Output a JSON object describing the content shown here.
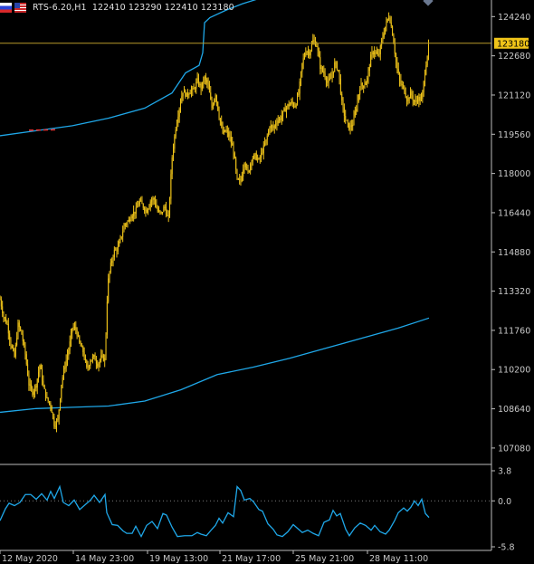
{
  "header": {
    "symbol": "RTS-6.20",
    "timeframe": "H1",
    "open": "122410",
    "high": "123290",
    "low": "122410",
    "close": "123180"
  },
  "colors": {
    "background": "#000000",
    "candle_up": "#f0c419",
    "candle_down": "#f0c419",
    "bands": "#1fa7e8",
    "oscillator": "#1fa7e8",
    "price_line": "#b89a2a",
    "axis_text": "#c8c8c8",
    "current_price_label_bg": "#f0c419",
    "band_marker_red": "#e03030"
  },
  "chart_data": [
    {
      "type": "candlestick",
      "panel": "main",
      "ylim": [
        106500,
        124900
      ],
      "y_ticks": [
        "124240",
        "122680",
        "121120",
        "119560",
        "118000",
        "116440",
        "114880",
        "113320",
        "111760",
        "110200",
        "108640",
        "107080"
      ],
      "current_price": "123180",
      "x_ticks": [
        "12 May 2020",
        "14 May 23:00",
        "19 May 13:00",
        "21 May 17:00",
        "25 May 21:00",
        "28 May 11:00"
      ],
      "close_path": [
        [
          0,
          113000
        ],
        [
          4,
          112300
        ],
        [
          8,
          112000
        ],
        [
          12,
          111200
        ],
        [
          16,
          110700
        ],
        [
          20,
          112000
        ],
        [
          24,
          111600
        ],
        [
          28,
          110800
        ],
        [
          32,
          109600
        ],
        [
          36,
          109300
        ],
        [
          40,
          109600
        ],
        [
          44,
          110400
        ],
        [
          48,
          109500
        ],
        [
          52,
          109000
        ],
        [
          56,
          108800
        ],
        [
          60,
          108000
        ],
        [
          64,
          108200
        ],
        [
          68,
          109700
        ],
        [
          72,
          110400
        ],
        [
          76,
          111000
        ],
        [
          80,
          111900
        ],
        [
          84,
          111800
        ],
        [
          88,
          111200
        ],
        [
          92,
          110900
        ],
        [
          96,
          110200
        ],
        [
          100,
          110600
        ],
        [
          104,
          110700
        ],
        [
          108,
          110400
        ],
        [
          112,
          110700
        ],
        [
          116,
          110600
        ],
        [
          119,
          113600
        ],
        [
          122,
          114300
        ],
        [
          126,
          114900
        ],
        [
          130,
          115000
        ],
        [
          134,
          115500
        ],
        [
          138,
          116000
        ],
        [
          142,
          116100
        ],
        [
          146,
          116400
        ],
        [
          150,
          116500
        ],
        [
          154,
          116900
        ],
        [
          158,
          116700
        ],
        [
          162,
          116500
        ],
        [
          166,
          116900
        ],
        [
          170,
          117000
        ],
        [
          174,
          116500
        ],
        [
          178,
          116400
        ],
        [
          182,
          116700
        ],
        [
          186,
          116100
        ],
        [
          190,
          118600
        ],
        [
          194,
          119800
        ],
        [
          198,
          120600
        ],
        [
          202,
          121300
        ],
        [
          206,
          121100
        ],
        [
          210,
          121300
        ],
        [
          214,
          121300
        ],
        [
          218,
          121700
        ],
        [
          222,
          121400
        ],
        [
          226,
          121800
        ],
        [
          230,
          121500
        ],
        [
          234,
          120600
        ],
        [
          238,
          121200
        ],
        [
          242,
          120300
        ],
        [
          246,
          119600
        ],
        [
          250,
          119700
        ],
        [
          254,
          119400
        ],
        [
          258,
          118900
        ],
        [
          262,
          117700
        ],
        [
          266,
          117700
        ],
        [
          270,
          118500
        ],
        [
          274,
          118000
        ],
        [
          278,
          118600
        ],
        [
          282,
          118700
        ],
        [
          286,
          118500
        ],
        [
          290,
          118900
        ],
        [
          294,
          119300
        ],
        [
          298,
          119900
        ],
        [
          302,
          119800
        ],
        [
          306,
          120100
        ],
        [
          310,
          120200
        ],
        [
          314,
          120500
        ],
        [
          318,
          120700
        ],
        [
          322,
          120800
        ],
        [
          326,
          120700
        ],
        [
          330,
          121200
        ],
        [
          334,
          122400
        ],
        [
          338,
          122900
        ],
        [
          342,
          122800
        ],
        [
          346,
          123300
        ],
        [
          350,
          123100
        ],
        [
          354,
          122200
        ],
        [
          358,
          122000
        ],
        [
          362,
          121600
        ],
        [
          366,
          121800
        ],
        [
          370,
          122400
        ],
        [
          374,
          122100
        ],
        [
          378,
          120700
        ],
        [
          382,
          120100
        ],
        [
          386,
          119800
        ],
        [
          390,
          120000
        ],
        [
          394,
          120700
        ],
        [
          398,
          121500
        ],
        [
          402,
          121500
        ],
        [
          406,
          121800
        ],
        [
          410,
          122700
        ],
        [
          414,
          122900
        ],
        [
          418,
          122600
        ],
        [
          422,
          123300
        ],
        [
          426,
          123900
        ],
        [
          430,
          124300
        ],
        [
          434,
          123500
        ],
        [
          438,
          122300
        ],
        [
          442,
          121600
        ],
        [
          446,
          121400
        ],
        [
          450,
          120900
        ],
        [
          454,
          121200
        ],
        [
          458,
          120800
        ],
        [
          462,
          121000
        ],
        [
          466,
          120900
        ],
        [
          470,
          122200
        ],
        [
          474,
          123180
        ]
      ],
      "series": [
        {
          "name": "",
          "role": "upper-band",
          "points": [
            [
              0,
              119500
            ],
            [
              40,
              119700
            ],
            [
              80,
              119900
            ],
            [
              120,
              120200
            ],
            [
              160,
              120600
            ],
            [
              190,
              121200
            ],
            [
              205,
              122000
            ],
            [
              220,
              122300
            ],
            [
              224,
              122800
            ],
            [
              226,
              124000
            ],
            [
              232,
              124200
            ],
            [
              250,
              124500
            ],
            [
              268,
              124750
            ],
            [
              290,
              125000
            ]
          ]
        },
        {
          "name": "",
          "role": "lower-band",
          "points": [
            [
              0,
              108500
            ],
            [
              40,
              108650
            ],
            [
              80,
              108700
            ],
            [
              120,
              108750
            ],
            [
              160,
              108950
            ],
            [
              200,
              109400
            ],
            [
              240,
              110000
            ],
            [
              280,
              110300
            ],
            [
              320,
              110650
            ],
            [
              360,
              111050
            ],
            [
              400,
              111450
            ],
            [
              440,
              111850
            ],
            [
              474,
              112250
            ]
          ]
        }
      ]
    },
    {
      "type": "line",
      "panel": "oscillator",
      "ylim": [
        -5.8,
        3.8
      ],
      "y_ticks": [
        "3.8",
        "0.0",
        "-5.8"
      ],
      "level_line": 0.0,
      "series": [
        {
          "name": "",
          "points": [
            [
              0,
              -2.5
            ],
            [
              6,
              -1.0
            ],
            [
              10,
              -0.3
            ],
            [
              16,
              -0.6
            ],
            [
              22,
              -0.2
            ],
            [
              28,
              0.8
            ],
            [
              34,
              0.8
            ],
            [
              40,
              0.2
            ],
            [
              46,
              0.9
            ],
            [
              52,
              0.1
            ],
            [
              56,
              1.2
            ],
            [
              60,
              0.3
            ],
            [
              66,
              1.8
            ],
            [
              70,
              -0.2
            ],
            [
              76,
              -0.6
            ],
            [
              82,
              0.1
            ],
            [
              88,
              -1.1
            ],
            [
              94,
              -0.5
            ],
            [
              100,
              0.1
            ],
            [
              104,
              0.7
            ],
            [
              110,
              -0.2
            ],
            [
              116,
              0.8
            ],
            [
              118,
              -1.5
            ],
            [
              124,
              -3.0
            ],
            [
              130,
              -3.1
            ],
            [
              136,
              -3.8
            ],
            [
              140,
              -4.1
            ],
            [
              146,
              -4.1
            ],
            [
              150,
              -3.2
            ],
            [
              156,
              -4.5
            ],
            [
              162,
              -3.1
            ],
            [
              168,
              -2.6
            ],
            [
              174,
              -3.5
            ],
            [
              180,
              -1.6
            ],
            [
              184,
              -1.8
            ],
            [
              190,
              -3.3
            ],
            [
              196,
              -4.5
            ],
            [
              204,
              -4.4
            ],
            [
              212,
              -4.4
            ],
            [
              218,
              -4.0
            ],
            [
              222,
              -4.2
            ],
            [
              228,
              -4.4
            ],
            [
              234,
              -3.6
            ],
            [
              238,
              -3.1
            ],
            [
              242,
              -2.2
            ],
            [
              246,
              -2.8
            ],
            [
              252,
              -1.5
            ],
            [
              258,
              -2.0
            ],
            [
              262,
              1.8
            ],
            [
              266,
              1.3
            ],
            [
              270,
              0.1
            ],
            [
              276,
              0.3
            ],
            [
              280,
              -0.1
            ],
            [
              286,
              -1.1
            ],
            [
              290,
              -1.3
            ],
            [
              296,
              -2.9
            ],
            [
              302,
              -3.6
            ],
            [
              306,
              -4.3
            ],
            [
              312,
              -4.5
            ],
            [
              318,
              -3.9
            ],
            [
              324,
              -3.0
            ],
            [
              330,
              -3.6
            ],
            [
              334,
              -4.0
            ],
            [
              340,
              -3.7
            ],
            [
              346,
              -4.1
            ],
            [
              352,
              -4.4
            ],
            [
              358,
              -2.7
            ],
            [
              364,
              -2.4
            ],
            [
              368,
              -1.2
            ],
            [
              372,
              -1.9
            ],
            [
              376,
              -1.6
            ],
            [
              382,
              -3.6
            ],
            [
              386,
              -4.4
            ],
            [
              392,
              -3.4
            ],
            [
              398,
              -2.8
            ],
            [
              404,
              -3.1
            ],
            [
              410,
              -3.7
            ],
            [
              414,
              -3.1
            ],
            [
              420,
              -3.9
            ],
            [
              426,
              -4.2
            ],
            [
              430,
              -3.7
            ],
            [
              436,
              -2.5
            ],
            [
              440,
              -1.5
            ],
            [
              446,
              -0.9
            ],
            [
              450,
              -1.3
            ],
            [
              454,
              -0.8
            ],
            [
              458,
              0.0
            ],
            [
              462,
              -0.6
            ],
            [
              466,
              0.2
            ],
            [
              470,
              -1.6
            ],
            [
              474,
              -2.1
            ]
          ]
        }
      ]
    }
  ]
}
